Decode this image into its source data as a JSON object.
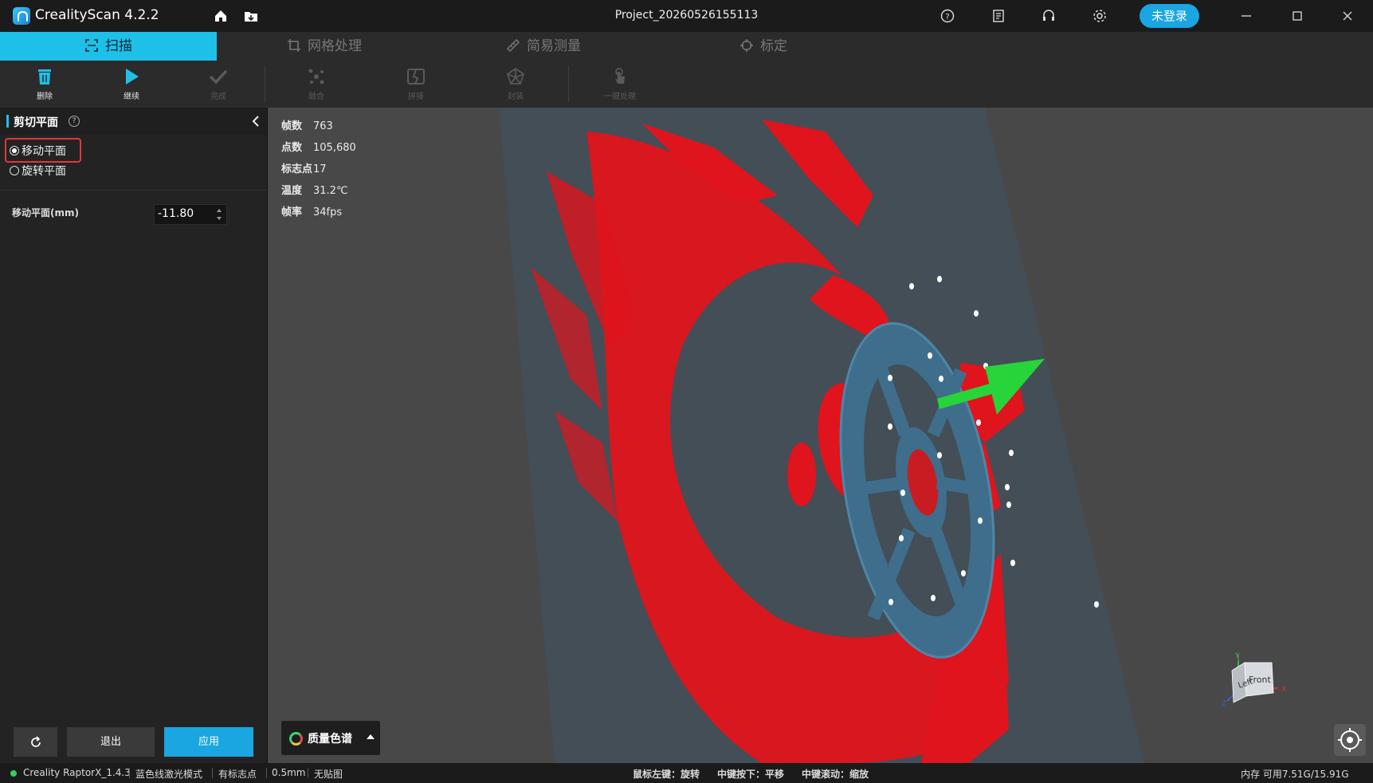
{
  "app": {
    "title": "CrealityScan 4.2.2",
    "project": "Project_20260526155113",
    "login_label": "未登录"
  },
  "colors": {
    "accent": "#1ec0e8",
    "login": "#1aa6e0",
    "highlight_box": "#e0383a",
    "scan_red": "#e0141c",
    "model_blue": "#3e6e8c",
    "arrow_green": "#27d43a"
  },
  "tabs": [
    {
      "label": "扫描",
      "icon": "scan-frame-icon",
      "active": true
    },
    {
      "label": "网格处理",
      "icon": "crop-icon",
      "active": false
    },
    {
      "label": "简易测量",
      "icon": "ruler-icon",
      "active": false
    },
    {
      "label": "标定",
      "icon": "target-icon",
      "active": false
    }
  ],
  "toolbar": {
    "items": [
      {
        "label": "删除",
        "icon": "trash-icon",
        "enabled": true
      },
      {
        "label": "继续",
        "icon": "play-icon",
        "enabled": true
      },
      {
        "label": "完成",
        "icon": "check-icon",
        "enabled": false
      },
      {
        "label": "融合",
        "icon": "fuse-icon",
        "enabled": false
      },
      {
        "label": "拼接",
        "icon": "stitch-icon",
        "enabled": false
      },
      {
        "label": "封装",
        "icon": "mesh-icon",
        "enabled": false
      },
      {
        "label": "一键处理",
        "icon": "one-click-icon",
        "enabled": false
      }
    ]
  },
  "panel": {
    "title": "剪切平面",
    "options": [
      {
        "label": "移动平面",
        "selected": true
      },
      {
        "label": "旋转平面",
        "selected": false
      }
    ],
    "field_label": "移动平面(mm)",
    "field_value": "-11.80",
    "exit_label": "退出",
    "apply_label": "应用"
  },
  "stats": [
    {
      "key": "帧数",
      "value": "763"
    },
    {
      "key": "点数",
      "value": "105,680"
    },
    {
      "key": "标志点",
      "value": "17"
    },
    {
      "key": "温度",
      "value": "31.2℃"
    },
    {
      "key": "帧率",
      "value": "34fps"
    }
  ],
  "legend_label": "质量色谱",
  "viewcube": {
    "left": "Left",
    "front": "Front",
    "x": "X",
    "y": "Y",
    "z": "Z"
  },
  "status": {
    "device": "Creality RaptorX_1.4.3",
    "mode": "蓝色线激光模式",
    "markers": "有标志点",
    "resolution": "0.5mm",
    "texture": "无贴图",
    "hint_rotate": "鼠标左键：旋转",
    "hint_pan": "中键按下：平移",
    "hint_zoom": "中键滚动：缩放",
    "memory": "内存 可用7.51G/15.91G"
  }
}
